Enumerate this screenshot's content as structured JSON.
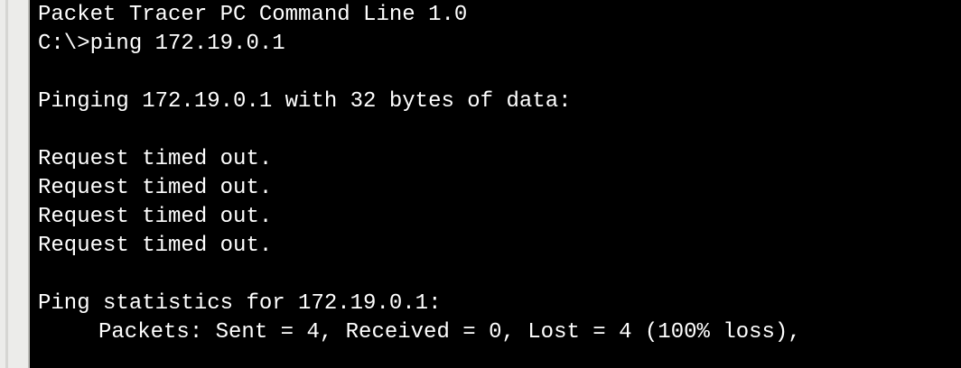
{
  "terminal": {
    "title_line": "Packet Tracer PC Command Line 1.0",
    "command_line": "C:\\>ping 172.19.0.1",
    "ping_header": "Pinging 172.19.0.1 with 32 bytes of data:",
    "responses": [
      "Request timed out.",
      "Request timed out.",
      "Request timed out.",
      "Request timed out."
    ],
    "stats_header": "Ping statistics for 172.19.0.1:",
    "stats_packets": "Packets: Sent = 4, Received = 0, Lost = 4 (100% loss),"
  }
}
